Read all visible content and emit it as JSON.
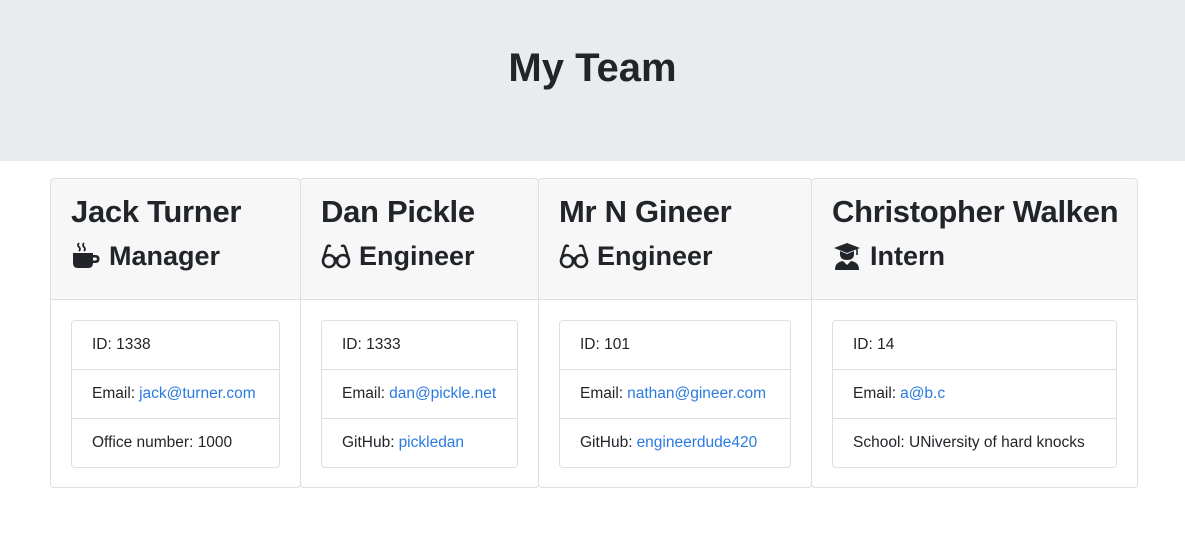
{
  "page": {
    "title": "My Team"
  },
  "team": [
    {
      "name": "Jack Turner",
      "role": "Manager",
      "icon": "mug-icon",
      "id_label": "ID:",
      "id": "1338",
      "email_label": "Email:",
      "email": "jack@turner.com",
      "extra_label": "Office number:",
      "extra": "1000"
    },
    {
      "name": "Dan Pickle",
      "role": "Engineer",
      "icon": "glasses-icon",
      "id_label": "ID:",
      "id": "1333",
      "email_label": "Email:",
      "email": "dan@pickle.net",
      "extra_label": "GitHub:",
      "extra": "pickledan"
    },
    {
      "name": "Mr N Gineer",
      "role": "Engineer",
      "icon": "glasses-icon",
      "id_label": "ID:",
      "id": "101",
      "email_label": "Email:",
      "email": "nathan@gineer.com",
      "extra_label": "GitHub:",
      "extra": "engineerdude420"
    },
    {
      "name": "Christopher Walken",
      "role": "Intern",
      "icon": "graduate-icon",
      "id_label": "ID:",
      "id": "14",
      "email_label": "Email:",
      "email": "a@b.c",
      "extra_label": "School:",
      "extra": "UNiversity of hard knocks"
    }
  ],
  "colors": {
    "jumbotron": "#e9ecef",
    "link": "#2a7ae2",
    "card_header": "#f7f7f7"
  }
}
